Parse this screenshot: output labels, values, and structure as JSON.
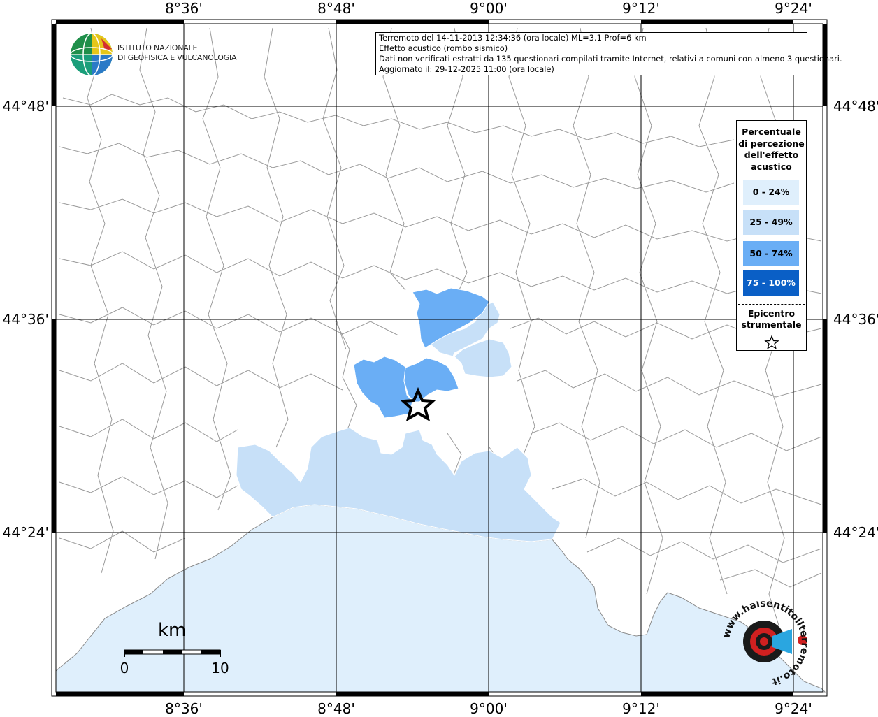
{
  "map": {
    "longitude_ticks": [
      "8°36'",
      "8°48'",
      "9°00'",
      "9°12'",
      "9°24'"
    ],
    "latitude_ticks": [
      "44°48'",
      "44°36'",
      "44°24'"
    ],
    "colors": {
      "sea": "#dfeffc",
      "land": "#ffffff",
      "border": "#8a8a8a",
      "grid": "#000000"
    }
  },
  "header": {
    "line1": "Terremoto del 14-11-2013 12:34:36 (ora locale) ML=3.1 Prof=6 km",
    "line2": "Effetto acustico (rombo sismico)",
    "line3": "Dati non verificati estratti da 135 questionari compilati tramite Internet, relativi a comuni con almeno 3 questionari.",
    "line4": "Aggiornato il: 29-12-2025 11:00 (ora locale)"
  },
  "logo": {
    "line1": "ISTITUTO NAZIONALE",
    "line2": "DI GEOFISICA E VULCANOLOGIA"
  },
  "legend": {
    "title": "Percentuale di percezione dell'effetto acustico",
    "classes": [
      {
        "label": "0 - 24%",
        "color": "#dfeffc",
        "text_color": "#000000"
      },
      {
        "label": "25 - 49%",
        "color": "#c7e0f8",
        "text_color": "#000000"
      },
      {
        "label": "50 - 74%",
        "color": "#6aaef5",
        "text_color": "#000000"
      },
      {
        "label": "75 - 100%",
        "color": "#0a5fc6",
        "text_color": "#ffffff"
      }
    ],
    "epicenter_label": "Epicentro strumentale",
    "epicenter_symbol": "star-outline-icon"
  },
  "scale_bar": {
    "unit": "km",
    "start": "0",
    "end": "10"
  },
  "watermark": {
    "text": "www.haisentitoilterremoto.it"
  }
}
